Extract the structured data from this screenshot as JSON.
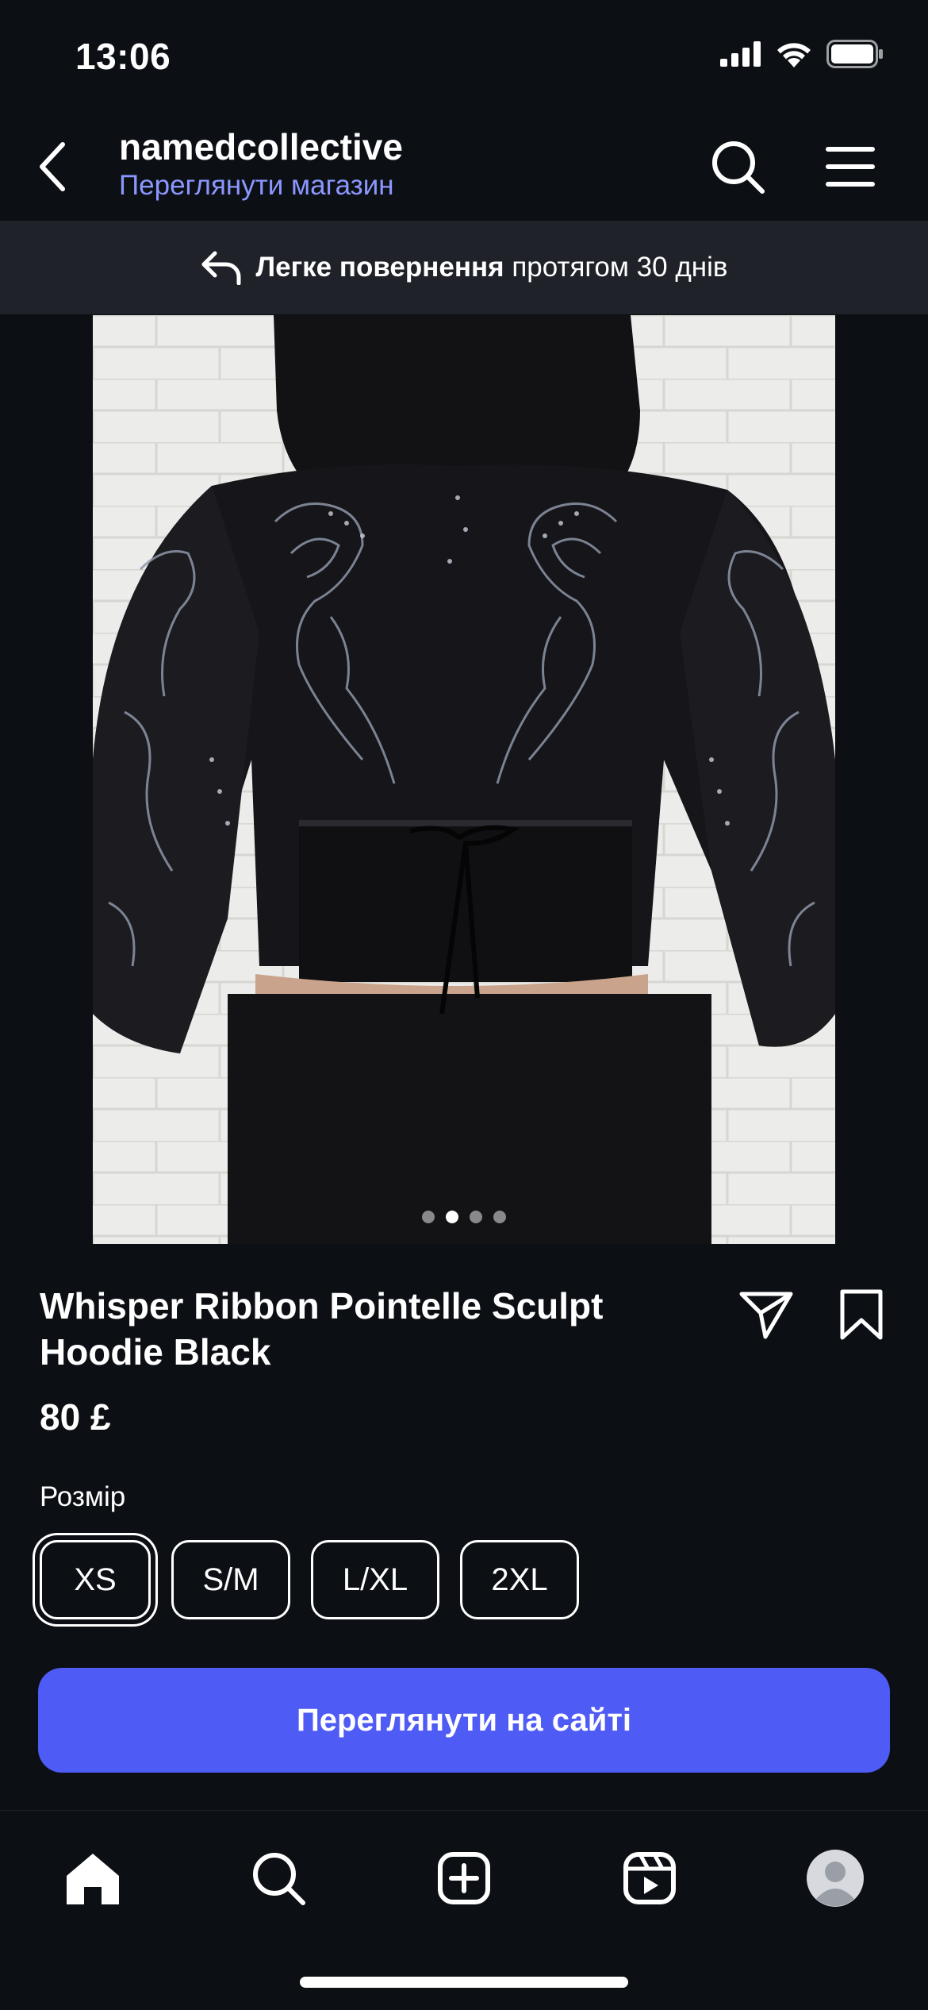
{
  "status_bar": {
    "time": "13:06"
  },
  "header": {
    "shop_name": "namedcollective",
    "shop_link": "Переглянути магазин"
  },
  "returns_banner": {
    "bold_text": "Легке повернення",
    "rest_text": " протягом 30 днів"
  },
  "product": {
    "title": "Whisper Ribbon Pointelle Sculpt Hoodie Black",
    "price": "80 £",
    "image_dots": {
      "count": 4,
      "active_index": 1
    },
    "size_label": "Розмір",
    "sizes": [
      "XS",
      "S/M",
      "L/XL",
      "2XL"
    ],
    "selected_size": "XS",
    "cta_label": "Переглянути на сайті"
  },
  "colors": {
    "background": "#0c0f14",
    "banner": "#1f2228",
    "accent": "#4f5bf5",
    "link": "#8b97ff"
  },
  "bottom_nav": {
    "items": [
      "home-icon",
      "search-icon",
      "create-icon",
      "reels-icon",
      "profile-avatar"
    ]
  }
}
